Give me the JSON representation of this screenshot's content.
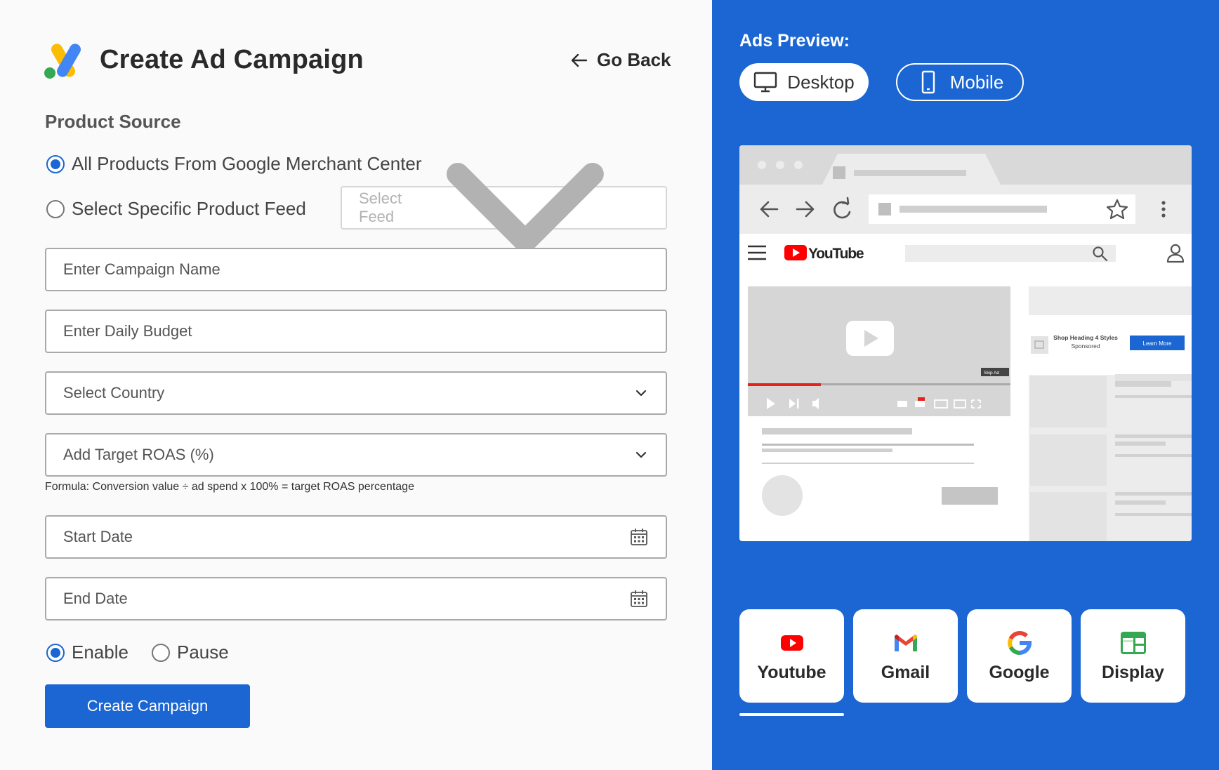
{
  "header": {
    "title": "Create Ad Campaign",
    "go_back_label": "Go Back"
  },
  "product_source": {
    "title": "Product Source",
    "options": [
      {
        "label": "All Products From Google Merchant Center",
        "selected": true
      },
      {
        "label": "Select Specific Product Feed",
        "selected": false
      }
    ],
    "feed_placeholder": "Select Feed"
  },
  "form": {
    "campaign_name_placeholder": "Enter Campaign Name",
    "daily_budget_placeholder": "Enter Daily Budget",
    "country_placeholder": "Select Country",
    "target_roas_placeholder": "Add Target ROAS (%)",
    "formula_note": "Formula: Conversion value ÷ ad spend x 100% = target ROAS percentage",
    "start_date_placeholder": "Start Date",
    "end_date_placeholder": "End Date"
  },
  "status": {
    "enable_label": "Enable",
    "pause_label": "Pause",
    "selected": "Enable"
  },
  "create_button_label": "Create Campaign",
  "preview": {
    "title": "Ads Preview:",
    "desktop_label": "Desktop",
    "mobile_label": "Mobile",
    "selected_view": "Desktop",
    "mock": {
      "site_logo_text": "YouTube",
      "ad_heading": "Shop Heading 4 Styles",
      "ad_sponsored": "Sponsored",
      "ad_cta": "Learn More",
      "skip_ad": "Skip Ad"
    },
    "platforms": [
      {
        "label": "Youtube",
        "icon": "youtube-icon",
        "active": true
      },
      {
        "label": "Gmail",
        "icon": "gmail-icon",
        "active": false
      },
      {
        "label": "Google",
        "icon": "google-icon",
        "active": false
      },
      {
        "label": "Display",
        "icon": "display-icon",
        "active": false
      }
    ]
  },
  "colors": {
    "accent": "#1b66d2",
    "youtube_red": "#ff0000",
    "google_blue": "#4285f4",
    "google_red": "#ea4335",
    "google_yellow": "#fbbc04",
    "google_green": "#34a853"
  }
}
